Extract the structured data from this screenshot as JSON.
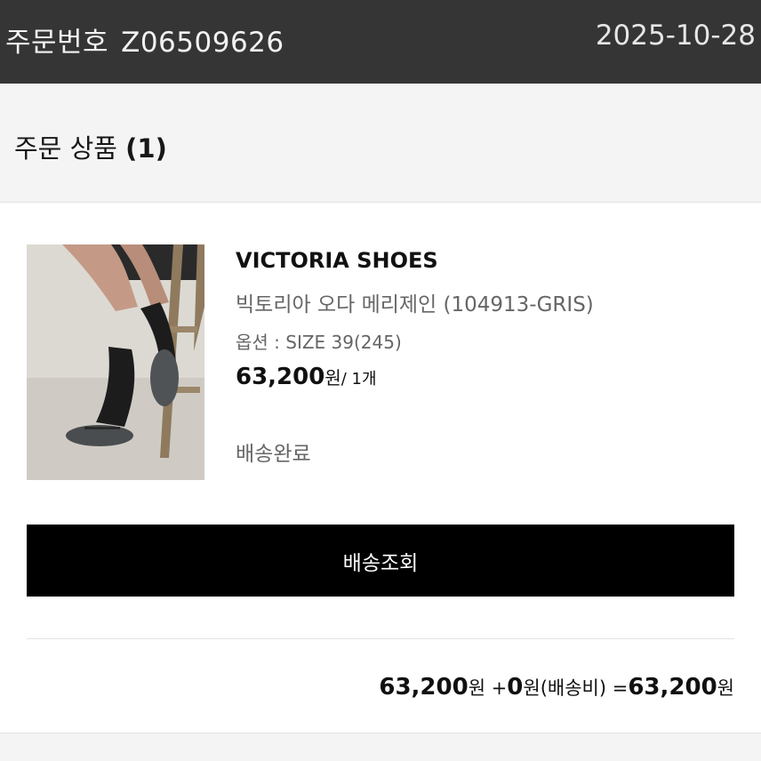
{
  "header": {
    "order_label": "주문번호",
    "order_number": "Z06509626",
    "order_date": "2025-10-28"
  },
  "section": {
    "title": "주문 상품",
    "count": "(1)"
  },
  "product": {
    "brand": "VICTORIA SHOES",
    "name": "빅토리아 오다 메리제인 (104913-GRIS)",
    "option": "옵션 : SIZE 39(245)",
    "price": "63,200",
    "price_unit": "원",
    "quantity": "/ 1개",
    "status": "배송완료"
  },
  "actions": {
    "track_label": "배송조회"
  },
  "totals": {
    "product_amount": "63,200",
    "won1": "원 +",
    "shipping_amount": "0",
    "shipping_label": "원(배송비) =",
    "total_amount": "63,200",
    "won2": "원"
  }
}
